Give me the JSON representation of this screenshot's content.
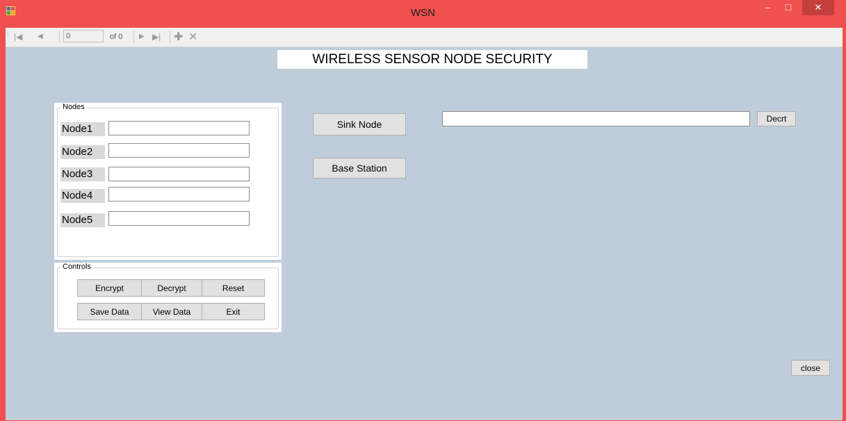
{
  "window": {
    "title": "WSN",
    "controls": {
      "minimize": "–",
      "maximize": "□",
      "close": "✕"
    }
  },
  "toolbar": {
    "position_value": "0",
    "count_text": "of 0",
    "icons": [
      "move-first-icon",
      "move-previous-icon",
      "move-next-icon",
      "move-last-icon",
      "add-new-icon",
      "delete-icon"
    ]
  },
  "main": {
    "header": "WIRELESS SENSOR NODE SECURITY",
    "sink_node_label": "Sink Node",
    "base_station_label": "Base Station",
    "status_value": "",
    "decrt_label": "Decrt",
    "close_label": "close"
  },
  "nodes": {
    "title": "Nodes",
    "items": [
      {
        "label": "Node1",
        "value": ""
      },
      {
        "label": "Node2",
        "value": ""
      },
      {
        "label": "Node3",
        "value": ""
      },
      {
        "label": "Node4",
        "value": ""
      },
      {
        "label": "Node5",
        "value": ""
      }
    ]
  },
  "controls": {
    "title": "Controls",
    "encrypt": "Encrypt",
    "decrypt": "Decrypt",
    "reset": "Reset",
    "save_data": "Save Data",
    "view_data": "View Data",
    "exit": "Exit"
  },
  "colors": {
    "window_frame": "#f05050",
    "client_background": "#bfcddb",
    "button_face": "#e1e1e1"
  }
}
